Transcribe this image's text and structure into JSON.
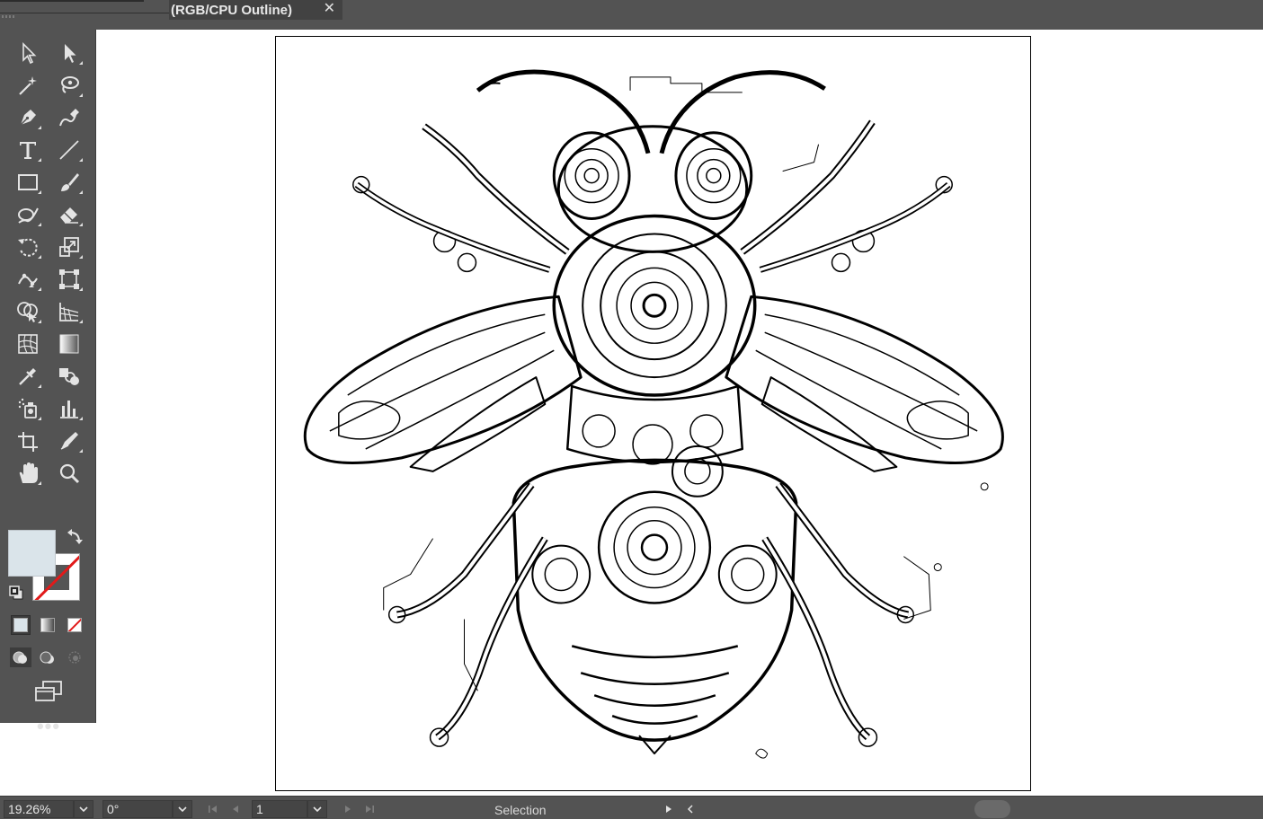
{
  "document": {
    "tab_title": "(RGB/CPU Outline)",
    "close_symbol": "✕"
  },
  "tools": [
    {
      "name": "selection-tool-icon"
    },
    {
      "name": "direct-selection-tool-icon"
    },
    {
      "name": "magic-wand-tool-icon"
    },
    {
      "name": "lasso-tool-icon"
    },
    {
      "name": "pen-tool-icon"
    },
    {
      "name": "curvature-tool-icon"
    },
    {
      "name": "type-tool-icon"
    },
    {
      "name": "line-segment-tool-icon"
    },
    {
      "name": "rectangle-tool-icon"
    },
    {
      "name": "paintbrush-tool-icon"
    },
    {
      "name": "shaper-tool-icon"
    },
    {
      "name": "eraser-tool-icon"
    },
    {
      "name": "rotate-tool-icon"
    },
    {
      "name": "scale-tool-icon"
    },
    {
      "name": "puppet-warp-tool-icon"
    },
    {
      "name": "free-transform-tool-icon"
    },
    {
      "name": "shape-builder-tool-icon"
    },
    {
      "name": "perspective-grid-tool-icon"
    },
    {
      "name": "mesh-tool-icon"
    },
    {
      "name": "gradient-tool-icon"
    },
    {
      "name": "eyedropper-tool-icon"
    },
    {
      "name": "blend-tool-icon"
    },
    {
      "name": "symbol-sprayer-tool-icon"
    },
    {
      "name": "column-graph-tool-icon"
    },
    {
      "name": "artboard-tool-icon"
    },
    {
      "name": "slice-tool-icon"
    },
    {
      "name": "hand-tool-icon"
    },
    {
      "name": "zoom-tool-icon"
    }
  ],
  "colors": {
    "fill": "#dae4ea",
    "stroke": "none",
    "panel_bg": "#535353"
  },
  "more_tools_label": "•••",
  "status": {
    "zoom": "19.26%",
    "rotation": "0°",
    "artboard_number": "1",
    "tool_name": "Selection"
  }
}
